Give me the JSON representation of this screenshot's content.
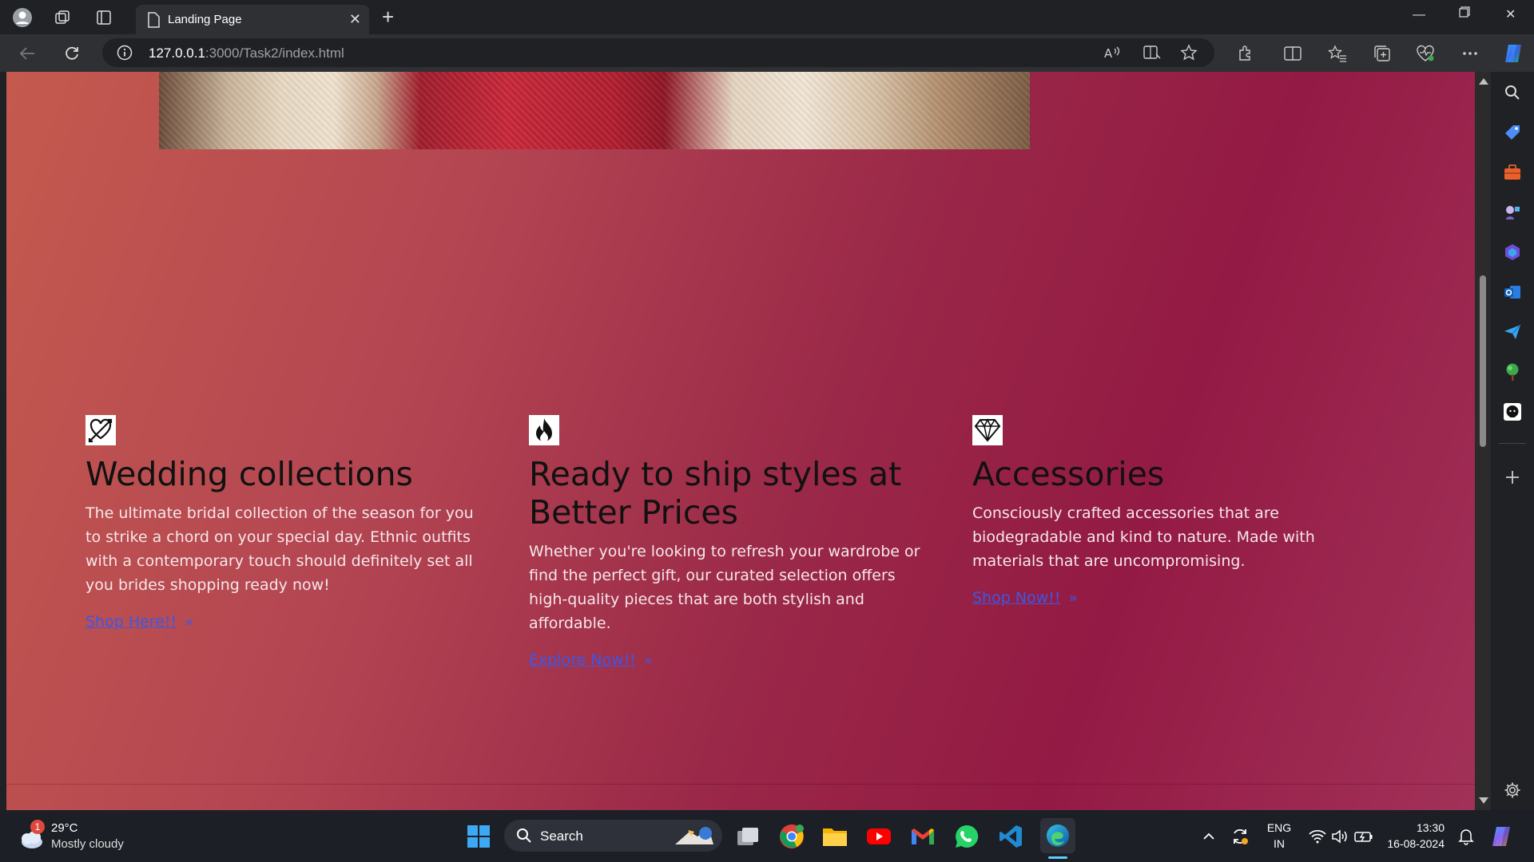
{
  "browser": {
    "tab_title": "Landing Page",
    "url_host": "127.0.0.1",
    "url_rest": ":3000/Task2/index.html"
  },
  "page": {
    "cards": [
      {
        "icon": "heart-arrow-icon",
        "title": "Wedding collections",
        "text": "The ultimate bridal collection of the season for you to strike a chord on your special day. Ethnic outfits with a contemporary touch should definitely set all you brides shopping ready now!",
        "link": "Shop Here!!"
      },
      {
        "icon": "flame-icon",
        "title": "Ready to ship styles at Better Prices",
        "text": "Whether you're looking to refresh your wardrobe or find the perfect gift, our curated selection offers high-quality pieces that are both stylish and affordable.",
        "link": "Explore Now!!"
      },
      {
        "icon": "diamond-icon",
        "title": "Accessories",
        "text": "Consciously crafted accessories that are biodegradable and kind to nature. Made with materials that are uncompromising.",
        "link": "Shop Now!!"
      }
    ]
  },
  "taskbar": {
    "weather_badge": "1",
    "weather_temp": "29°C",
    "weather_cond": "Mostly cloudy",
    "search_label": "Search",
    "lang_top": "ENG",
    "lang_bottom": "IN",
    "time": "13:30",
    "date": "16-08-2024"
  },
  "colors": {
    "link": "#3c58e6",
    "page_gradient_start": "#c45a4e",
    "page_gradient_mid": "#931a44"
  }
}
